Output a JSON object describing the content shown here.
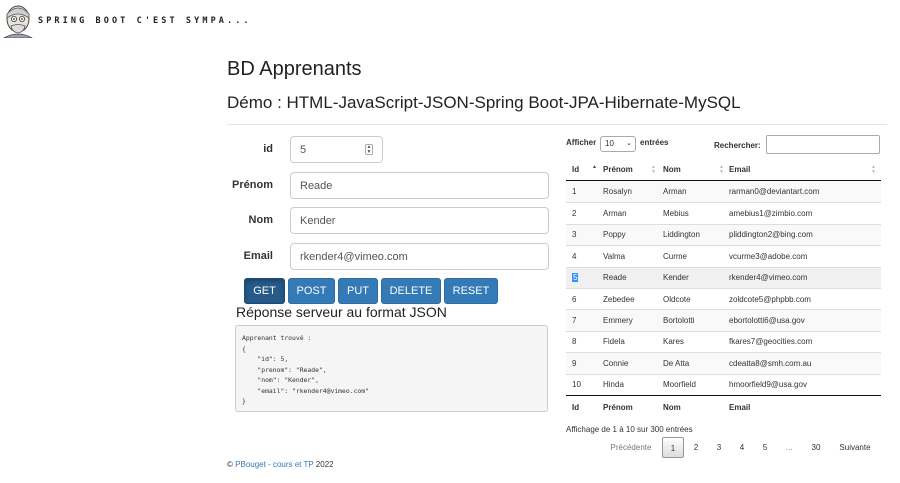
{
  "header": {
    "brand": "SPRING BOOT C'EST SYMPA...",
    "avatar_icon": "cartoon-face-icon"
  },
  "page": {
    "title": "BD Apprenants",
    "subtitle": "Démo : HTML-JavaScript-JSON-Spring Boot-JPA-Hibernate-MySQL"
  },
  "form": {
    "id_label": "id",
    "id_value": "5",
    "prenom_label": "Prénom",
    "prenom_value": "Reade",
    "nom_label": "Nom",
    "nom_value": "Kender",
    "email_label": "Email",
    "email_value": "rkender4@vimeo.com"
  },
  "buttons": {
    "get": "GET",
    "post": "POST",
    "put": "PUT",
    "delete": "DELETE",
    "reset": "RESET"
  },
  "response": {
    "title": "Réponse serveur au format JSON",
    "body": "Apprenant trouvé :\n{\n    \"id\": 5,\n    \"prenom\": \"Reade\",\n    \"nom\": \"Kender\",\n    \"email\": \"rkender4@vimeo.com\"\n}"
  },
  "table": {
    "show_label": "Afficher",
    "page_length": "10",
    "entries_label": "entrées",
    "search_label": "Rechercher:",
    "search_value": "",
    "columns": [
      "Id",
      "Prénom",
      "Nom",
      "Email"
    ],
    "rows": [
      {
        "id": "1",
        "prenom": "Rosalyn",
        "nom": "Arman",
        "email": "rarman0@deviantart.com"
      },
      {
        "id": "2",
        "prenom": "Arman",
        "nom": "Mebius",
        "email": "amebius1@zimbio.com"
      },
      {
        "id": "3",
        "prenom": "Poppy",
        "nom": "Liddington",
        "email": "pliddington2@bing.com"
      },
      {
        "id": "4",
        "prenom": "Valma",
        "nom": "Curme",
        "email": "vcurme3@adobe.com"
      },
      {
        "id": "5",
        "prenom": "Reade",
        "nom": "Kender",
        "email": "rkender4@vimeo.com"
      },
      {
        "id": "6",
        "prenom": "Zebedee",
        "nom": "Oldcote",
        "email": "zoldcote5@phpbb.com"
      },
      {
        "id": "7",
        "prenom": "Emmery",
        "nom": "Bortolotti",
        "email": "ebortolotti6@usa.gov"
      },
      {
        "id": "8",
        "prenom": "Fidela",
        "nom": "Kares",
        "email": "fkares7@geocities.com"
      },
      {
        "id": "9",
        "prenom": "Connie",
        "nom": "De Atta",
        "email": "cdeatta8@smh.com.au"
      },
      {
        "id": "10",
        "prenom": "Hinda",
        "nom": "Moorfield",
        "email": "hmoorfield9@usa.gov"
      }
    ],
    "info": "Affichage de 1 à 10 sur 300 entrées",
    "pagination": {
      "previous": "Précédente",
      "pages": [
        "1",
        "2",
        "3",
        "4",
        "5"
      ],
      "ellipsis": "…",
      "last": "30",
      "next": "Suivante"
    }
  },
  "footer": {
    "copyright": "©",
    "link": "PBouget - cours et TP",
    "year": "2022"
  }
}
